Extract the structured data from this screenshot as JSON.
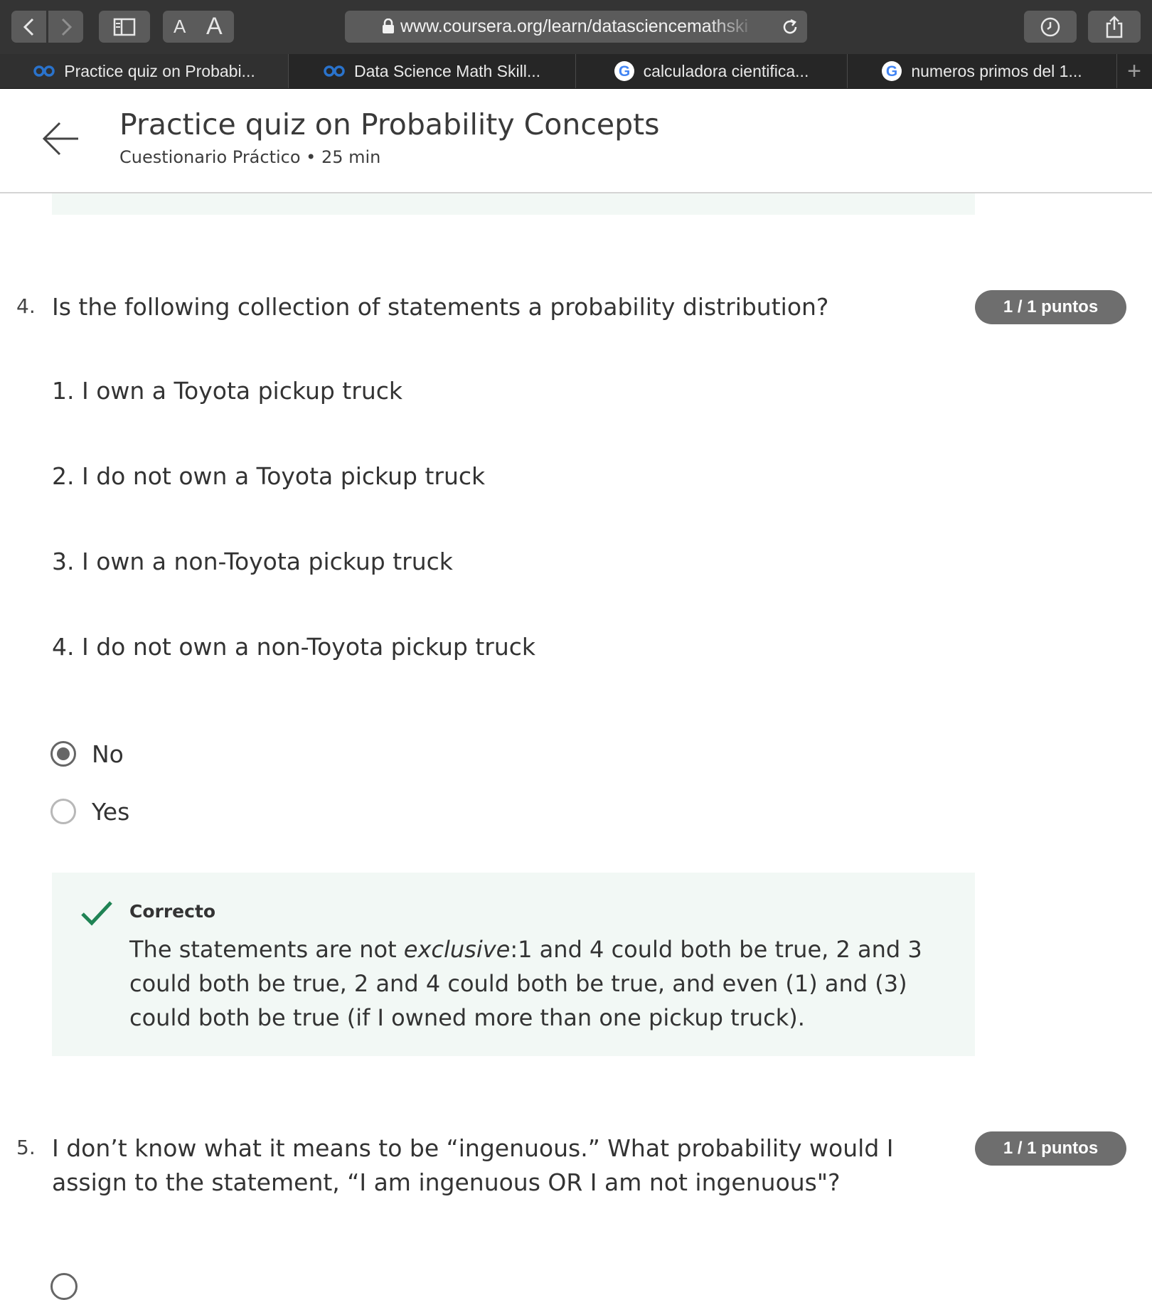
{
  "browser": {
    "url": "www.coursera.org/learn/datasciencemathskills",
    "font_small_label": "A",
    "font_large_label": "A",
    "tabs": [
      {
        "label": "Practice quiz on Probabi...",
        "icon": "coursera-icon"
      },
      {
        "label": "Data Science Math Skill...",
        "icon": "coursera-icon"
      },
      {
        "label": "calculadora cientifica...",
        "icon": "google-icon"
      },
      {
        "label": "numeros primos del 1...",
        "icon": "google-icon"
      }
    ],
    "new_tab_label": "+"
  },
  "header": {
    "title": "Practice quiz on Probability Concepts",
    "subtitle": "Cuestionario Práctico • 25 min"
  },
  "q4": {
    "number": "4.",
    "text": "Is the following collection of statements a probability distribution?",
    "points": "1 / 1 puntos",
    "statements": [
      "1. I own a Toyota pickup truck",
      "2. I do not own a Toyota pickup truck",
      "3. I own a non-Toyota pickup truck",
      "4. I do not own a non-Toyota pickup truck"
    ],
    "options": [
      {
        "label": "No",
        "selected": true
      },
      {
        "label": "Yes",
        "selected": false
      }
    ],
    "feedback": {
      "status": "Correcto",
      "text_before": "The statements are not ",
      "text_emph": "exclusive",
      "text_after": ":1 and 4 could both be true, 2 and 3 could both be true, 2 and 4 could both be true, and even (1) and (3) could both be true (if I owned more than one pickup truck)."
    }
  },
  "q5": {
    "number": "5.",
    "text": "I don’t know what it means to be “ingenuous.” What probability would I assign to the statement, “I am ingenuous OR I am not ingenuous\"?",
    "points": "1 / 1 puntos"
  },
  "colors": {
    "chrome_bg": "#343434",
    "tab_bg": "#262626",
    "feedback_bg": "#f2f8f5",
    "check_green": "#1f8354",
    "badge_gray": "#6e6e6e"
  }
}
